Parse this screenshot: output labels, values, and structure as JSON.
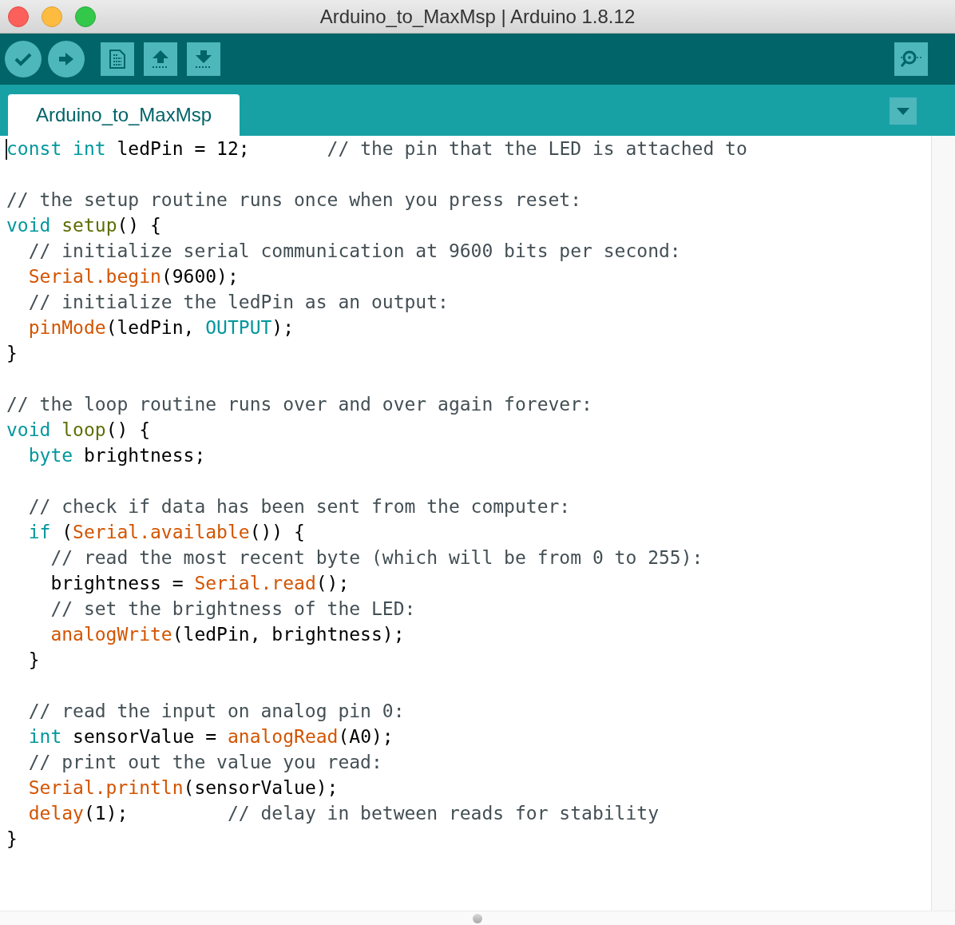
{
  "window": {
    "title": "Arduino_to_MaxMsp | Arduino 1.8.12"
  },
  "tabs": [
    {
      "label": "Arduino_to_MaxMsp",
      "selected": true
    }
  ],
  "editor": {
    "lines": [
      {
        "kind": "code",
        "tokens": [
          {
            "kind": "keyword",
            "text": "const"
          },
          {
            "kind": "keyword",
            "text": " int"
          },
          {
            "kind": "plain",
            "text": " ledPin = 12;"
          },
          {
            "kind": "comment",
            "text": "       // the pin that the LED is attached to"
          }
        ]
      },
      {
        "kind": "blank"
      },
      {
        "kind": "code",
        "tokens": [
          {
            "kind": "comment",
            "text": "// the setup routine runs once when you press reset:"
          }
        ]
      },
      {
        "kind": "code",
        "tokens": [
          {
            "kind": "keyword",
            "text": "void"
          },
          {
            "kind": "structure",
            "text": " setup"
          },
          {
            "kind": "plain",
            "text": "() {"
          }
        ]
      },
      {
        "kind": "code",
        "tokens": [
          {
            "kind": "comment",
            "text": "  // initialize serial communication at 9600 bits per second:"
          }
        ]
      },
      {
        "kind": "code",
        "tokens": [
          {
            "kind": "function",
            "text": "  Serial.begin"
          },
          {
            "kind": "plain",
            "text": "(9600);"
          }
        ]
      },
      {
        "kind": "code",
        "tokens": [
          {
            "kind": "comment",
            "text": "  // initialize the ledPin as an output:"
          }
        ]
      },
      {
        "kind": "code",
        "tokens": [
          {
            "kind": "function",
            "text": "  pinMode"
          },
          {
            "kind": "plain",
            "text": "(ledPin,"
          },
          {
            "kind": "keyword",
            "text": " OUTPUT"
          },
          {
            "kind": "plain",
            "text": ");"
          }
        ]
      },
      {
        "kind": "code",
        "tokens": [
          {
            "kind": "plain",
            "text": "}"
          }
        ]
      },
      {
        "kind": "blank"
      },
      {
        "kind": "code",
        "tokens": [
          {
            "kind": "comment",
            "text": "// the loop routine runs over and over again forever:"
          }
        ]
      },
      {
        "kind": "code",
        "tokens": [
          {
            "kind": "keyword",
            "text": "void"
          },
          {
            "kind": "structure",
            "text": " loop"
          },
          {
            "kind": "plain",
            "text": "() {"
          }
        ]
      },
      {
        "kind": "code",
        "tokens": [
          {
            "kind": "keyword",
            "text": "  byte"
          },
          {
            "kind": "plain",
            "text": " brightness;"
          }
        ]
      },
      {
        "kind": "blank"
      },
      {
        "kind": "code",
        "tokens": [
          {
            "kind": "comment",
            "text": "  // check if data has been sent from the computer:"
          }
        ]
      },
      {
        "kind": "code",
        "tokens": [
          {
            "kind": "keyword",
            "text": "  if"
          },
          {
            "kind": "plain",
            "text": " ("
          },
          {
            "kind": "function",
            "text": "Serial.available"
          },
          {
            "kind": "plain",
            "text": "()) {"
          }
        ]
      },
      {
        "kind": "code",
        "tokens": [
          {
            "kind": "comment",
            "text": "    // read the most recent byte (which will be from 0 to 255):"
          }
        ]
      },
      {
        "kind": "code",
        "tokens": [
          {
            "kind": "plain",
            "text": "    brightness ="
          },
          {
            "kind": "function",
            "text": " Serial.read"
          },
          {
            "kind": "plain",
            "text": "();"
          }
        ]
      },
      {
        "kind": "code",
        "tokens": [
          {
            "kind": "comment",
            "text": "    // set the brightness of the LED:"
          }
        ]
      },
      {
        "kind": "code",
        "tokens": [
          {
            "kind": "function",
            "text": "    analogWrite"
          },
          {
            "kind": "plain",
            "text": "(ledPin, brightness);"
          }
        ]
      },
      {
        "kind": "code",
        "tokens": [
          {
            "kind": "plain",
            "text": "  }"
          }
        ]
      },
      {
        "kind": "blank"
      },
      {
        "kind": "code",
        "tokens": [
          {
            "kind": "comment",
            "text": "  // read the input on analog pin 0:"
          }
        ]
      },
      {
        "kind": "code",
        "tokens": [
          {
            "kind": "keyword",
            "text": "  int"
          },
          {
            "kind": "plain",
            "text": " sensorValue ="
          },
          {
            "kind": "function",
            "text": " analogRead"
          },
          {
            "kind": "plain",
            "text": "(A0);"
          }
        ]
      },
      {
        "kind": "code",
        "tokens": [
          {
            "kind": "comment",
            "text": "  // print out the value you read:"
          }
        ]
      },
      {
        "kind": "code",
        "tokens": [
          {
            "kind": "function",
            "text": "  Serial.println"
          },
          {
            "kind": "plain",
            "text": "(sensorValue);"
          }
        ]
      },
      {
        "kind": "code",
        "tokens": [
          {
            "kind": "function",
            "text": "  delay"
          },
          {
            "kind": "plain",
            "text": "(1);"
          },
          {
            "kind": "comment",
            "text": "         // delay in between reads for stability"
          }
        ]
      },
      {
        "kind": "code",
        "tokens": [
          {
            "kind": "plain",
            "text": "}"
          }
        ]
      }
    ]
  }
}
